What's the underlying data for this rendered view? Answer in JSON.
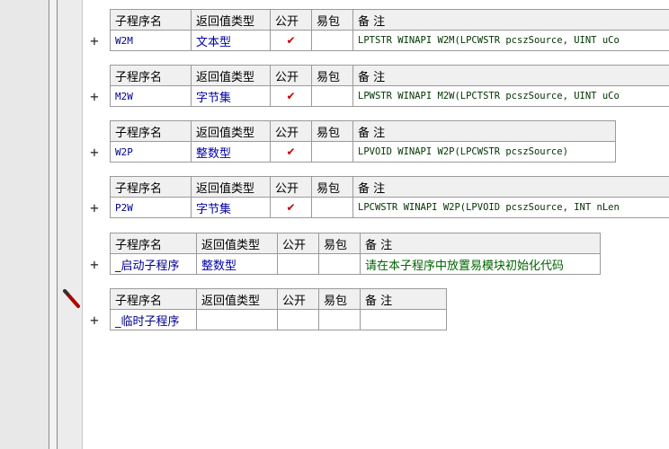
{
  "headers": {
    "name": "子程序名",
    "return_type": "返回值类型",
    "public": "公开",
    "easy_pkg": "易包",
    "note": "备 注"
  },
  "expand_symbol": "+",
  "check_mark": "✔",
  "subroutines": [
    {
      "name": "W2M",
      "return_type": "文本型",
      "public": "✔",
      "easy_pkg": "",
      "note": "LPTSTR WINAPI W2M(LPCWSTR pcszSource, UINT uCo"
    },
    {
      "name": "M2W",
      "return_type": "字节集",
      "public": "✔",
      "easy_pkg": "",
      "note": "LPWSTR WINAPI M2W(LPCTSTR pcszSource, UINT uCo"
    },
    {
      "name": "W2P",
      "return_type": "整数型",
      "public": "✔",
      "easy_pkg": "",
      "note": "LPVOID WINAPI W2P(LPCWSTR pcszSource)"
    },
    {
      "name": "P2W",
      "return_type": "字节集",
      "public": "✔",
      "easy_pkg": "",
      "note": "LPCWSTR WINAPI W2P(LPVOID pcszSource, INT nLen"
    },
    {
      "name": "_启动子程序",
      "return_type": "整数型",
      "public": "",
      "easy_pkg": "",
      "note": "请在本子程序中放置易模块初始化代码"
    },
    {
      "name": "_临时子程序",
      "return_type": "",
      "public": "",
      "easy_pkg": "",
      "note": ""
    }
  ],
  "icons": {
    "cursor": "pencil-icon"
  },
  "colors": {
    "check": "#c00000",
    "type": "#0000aa",
    "note_cn": "#006400"
  }
}
